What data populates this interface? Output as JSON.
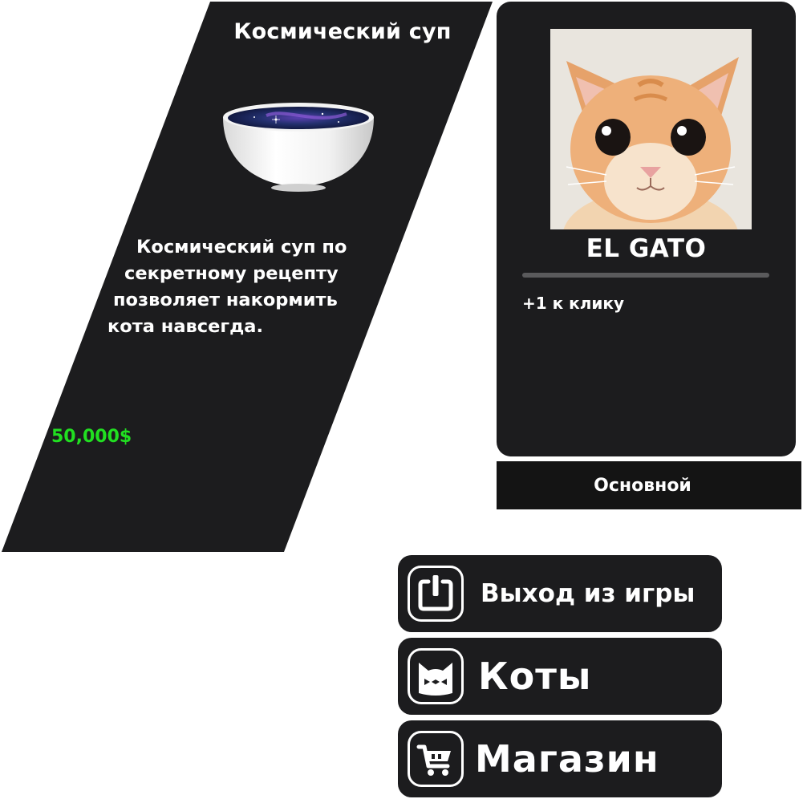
{
  "item": {
    "title": "Космический суп",
    "image_icon": "cosmic-soup-bowl",
    "description_lines": [
      "Космический суп по",
      "секретному рецепту",
      "позволяет накормить",
      "кота навсегда."
    ],
    "price": "50,000$",
    "price_color": "#21e021"
  },
  "cat": {
    "name": "EL GATO",
    "bonus": "+1 к клику",
    "photo_icon": "kitten-photo"
  },
  "category_tab": {
    "label": "Основной"
  },
  "menu": {
    "exit": {
      "label": "Выход из игры",
      "icon": "power-icon"
    },
    "cats": {
      "label": "Коты",
      "icon": "cat-face-icon"
    },
    "shop": {
      "label": "Магазин",
      "icon": "shopping-cart-icon"
    }
  },
  "colors": {
    "panel": "#1c1c1e",
    "background": "#ffffff",
    "text": "#ffffff"
  }
}
